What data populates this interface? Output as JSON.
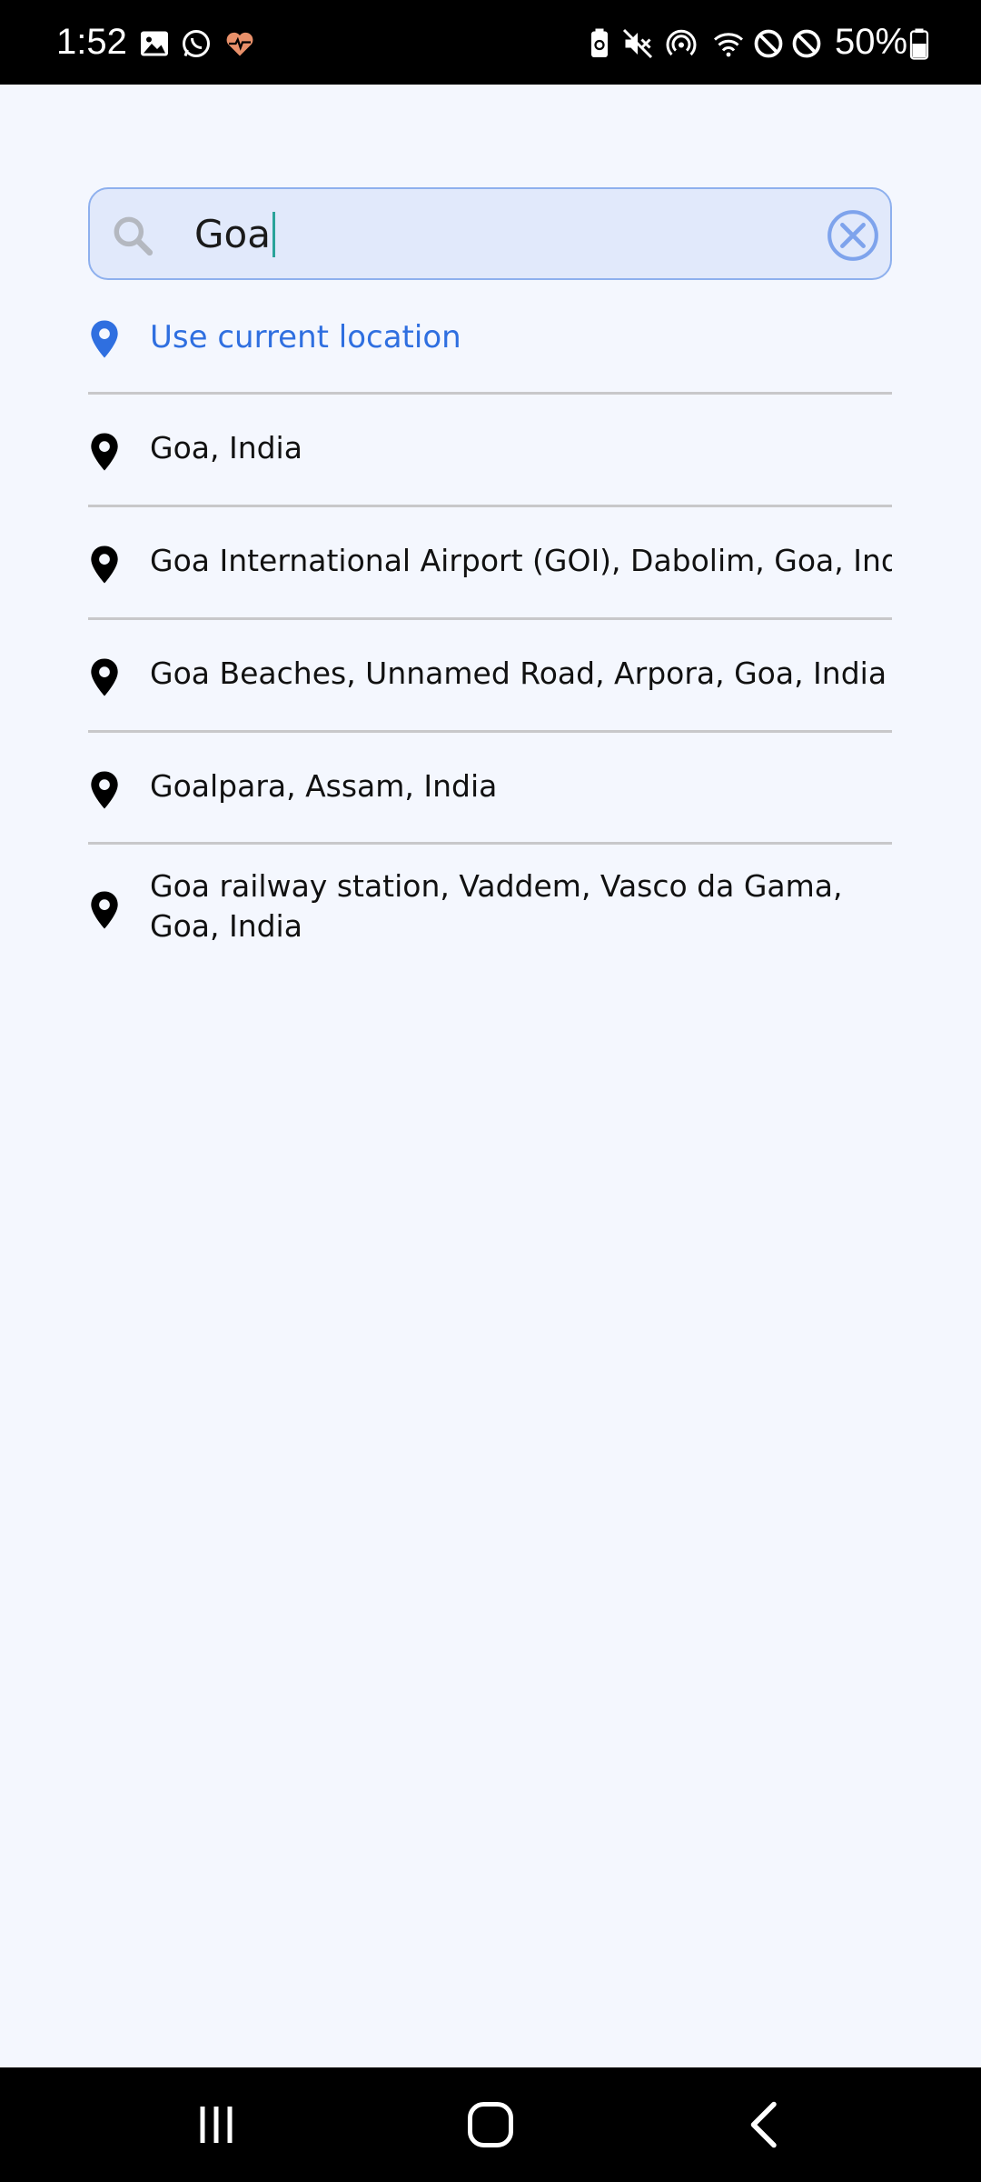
{
  "status_bar": {
    "time": "1:52",
    "battery": "50%",
    "notification_icons": [
      "gallery-icon",
      "whatsapp-icon",
      "health-icon"
    ],
    "system_icons": [
      "battery-saver-icon",
      "mute-icon",
      "hotspot-icon",
      "wifi-icon",
      "block-icon",
      "block-icon",
      "battery-icon"
    ]
  },
  "search": {
    "value": "Goa"
  },
  "current_location": {
    "label": "Use current location"
  },
  "results": [
    {
      "label": "Goa, India"
    },
    {
      "label": "Goa International Airport (GOI), Dabolim, Goa, India"
    },
    {
      "label": "Goa Beaches, Unnamed Road, Arpora, Goa, India"
    },
    {
      "label": "Goalpara, Assam, India"
    },
    {
      "label": "Goa railway station, Vaddem, Vasco da Gama, Goa, India"
    }
  ],
  "colors": {
    "accent": "#2f6fe0",
    "search_bg": "#e1e9fb",
    "search_border": "#8eb0ee",
    "page_bg": "#f4f7fe",
    "health_icon": "#e8906a"
  }
}
